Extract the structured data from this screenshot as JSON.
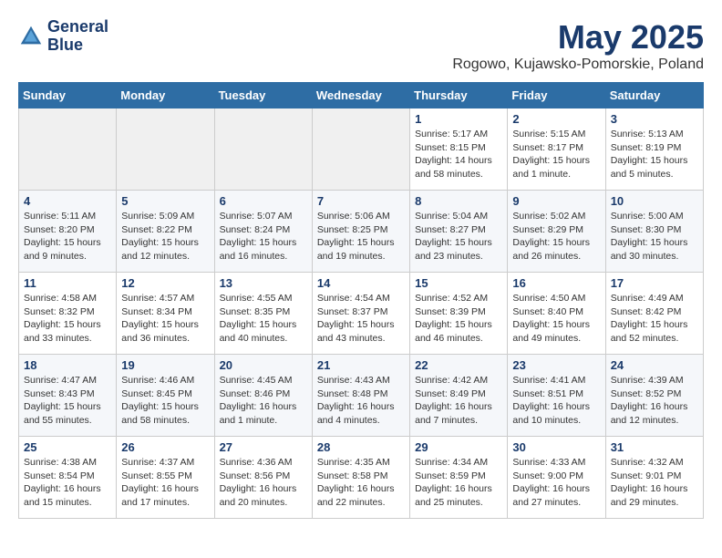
{
  "header": {
    "logo_line1": "General",
    "logo_line2": "Blue",
    "month": "May 2025",
    "location": "Rogowo, Kujawsko-Pomorskie, Poland"
  },
  "days_of_week": [
    "Sunday",
    "Monday",
    "Tuesday",
    "Wednesday",
    "Thursday",
    "Friday",
    "Saturday"
  ],
  "weeks": [
    [
      {
        "day": "",
        "info": ""
      },
      {
        "day": "",
        "info": ""
      },
      {
        "day": "",
        "info": ""
      },
      {
        "day": "",
        "info": ""
      },
      {
        "day": "1",
        "info": "Sunrise: 5:17 AM\nSunset: 8:15 PM\nDaylight: 14 hours\nand 58 minutes."
      },
      {
        "day": "2",
        "info": "Sunrise: 5:15 AM\nSunset: 8:17 PM\nDaylight: 15 hours\nand 1 minute."
      },
      {
        "day": "3",
        "info": "Sunrise: 5:13 AM\nSunset: 8:19 PM\nDaylight: 15 hours\nand 5 minutes."
      }
    ],
    [
      {
        "day": "4",
        "info": "Sunrise: 5:11 AM\nSunset: 8:20 PM\nDaylight: 15 hours\nand 9 minutes."
      },
      {
        "day": "5",
        "info": "Sunrise: 5:09 AM\nSunset: 8:22 PM\nDaylight: 15 hours\nand 12 minutes."
      },
      {
        "day": "6",
        "info": "Sunrise: 5:07 AM\nSunset: 8:24 PM\nDaylight: 15 hours\nand 16 minutes."
      },
      {
        "day": "7",
        "info": "Sunrise: 5:06 AM\nSunset: 8:25 PM\nDaylight: 15 hours\nand 19 minutes."
      },
      {
        "day": "8",
        "info": "Sunrise: 5:04 AM\nSunset: 8:27 PM\nDaylight: 15 hours\nand 23 minutes."
      },
      {
        "day": "9",
        "info": "Sunrise: 5:02 AM\nSunset: 8:29 PM\nDaylight: 15 hours\nand 26 minutes."
      },
      {
        "day": "10",
        "info": "Sunrise: 5:00 AM\nSunset: 8:30 PM\nDaylight: 15 hours\nand 30 minutes."
      }
    ],
    [
      {
        "day": "11",
        "info": "Sunrise: 4:58 AM\nSunset: 8:32 PM\nDaylight: 15 hours\nand 33 minutes."
      },
      {
        "day": "12",
        "info": "Sunrise: 4:57 AM\nSunset: 8:34 PM\nDaylight: 15 hours\nand 36 minutes."
      },
      {
        "day": "13",
        "info": "Sunrise: 4:55 AM\nSunset: 8:35 PM\nDaylight: 15 hours\nand 40 minutes."
      },
      {
        "day": "14",
        "info": "Sunrise: 4:54 AM\nSunset: 8:37 PM\nDaylight: 15 hours\nand 43 minutes."
      },
      {
        "day": "15",
        "info": "Sunrise: 4:52 AM\nSunset: 8:39 PM\nDaylight: 15 hours\nand 46 minutes."
      },
      {
        "day": "16",
        "info": "Sunrise: 4:50 AM\nSunset: 8:40 PM\nDaylight: 15 hours\nand 49 minutes."
      },
      {
        "day": "17",
        "info": "Sunrise: 4:49 AM\nSunset: 8:42 PM\nDaylight: 15 hours\nand 52 minutes."
      }
    ],
    [
      {
        "day": "18",
        "info": "Sunrise: 4:47 AM\nSunset: 8:43 PM\nDaylight: 15 hours\nand 55 minutes."
      },
      {
        "day": "19",
        "info": "Sunrise: 4:46 AM\nSunset: 8:45 PM\nDaylight: 15 hours\nand 58 minutes."
      },
      {
        "day": "20",
        "info": "Sunrise: 4:45 AM\nSunset: 8:46 PM\nDaylight: 16 hours\nand 1 minute."
      },
      {
        "day": "21",
        "info": "Sunrise: 4:43 AM\nSunset: 8:48 PM\nDaylight: 16 hours\nand 4 minutes."
      },
      {
        "day": "22",
        "info": "Sunrise: 4:42 AM\nSunset: 8:49 PM\nDaylight: 16 hours\nand 7 minutes."
      },
      {
        "day": "23",
        "info": "Sunrise: 4:41 AM\nSunset: 8:51 PM\nDaylight: 16 hours\nand 10 minutes."
      },
      {
        "day": "24",
        "info": "Sunrise: 4:39 AM\nSunset: 8:52 PM\nDaylight: 16 hours\nand 12 minutes."
      }
    ],
    [
      {
        "day": "25",
        "info": "Sunrise: 4:38 AM\nSunset: 8:54 PM\nDaylight: 16 hours\nand 15 minutes."
      },
      {
        "day": "26",
        "info": "Sunrise: 4:37 AM\nSunset: 8:55 PM\nDaylight: 16 hours\nand 17 minutes."
      },
      {
        "day": "27",
        "info": "Sunrise: 4:36 AM\nSunset: 8:56 PM\nDaylight: 16 hours\nand 20 minutes."
      },
      {
        "day": "28",
        "info": "Sunrise: 4:35 AM\nSunset: 8:58 PM\nDaylight: 16 hours\nand 22 minutes."
      },
      {
        "day": "29",
        "info": "Sunrise: 4:34 AM\nSunset: 8:59 PM\nDaylight: 16 hours\nand 25 minutes."
      },
      {
        "day": "30",
        "info": "Sunrise: 4:33 AM\nSunset: 9:00 PM\nDaylight: 16 hours\nand 27 minutes."
      },
      {
        "day": "31",
        "info": "Sunrise: 4:32 AM\nSunset: 9:01 PM\nDaylight: 16 hours\nand 29 minutes."
      }
    ]
  ]
}
